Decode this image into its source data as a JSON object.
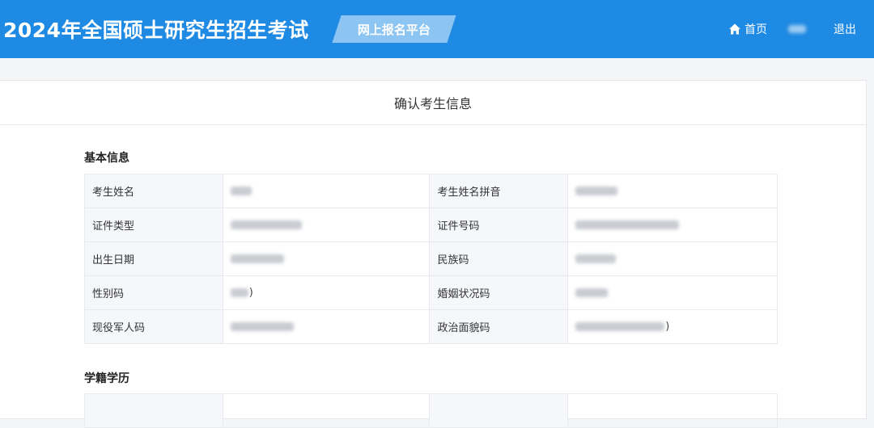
{
  "header": {
    "title": "2024年全国硕士研究生招生考试",
    "platform": "网上报名平台",
    "nav": {
      "home": "首页",
      "logout": "退出"
    }
  },
  "page": {
    "title": "确认考生信息"
  },
  "basic_info": {
    "section_title": "基本信息",
    "rows": [
      {
        "label_a": "考生姓名",
        "label_b": "考生姓名拼音"
      },
      {
        "label_a": "证件类型",
        "label_b": "证件号码"
      },
      {
        "label_a": "出生日期",
        "label_b": "民族码"
      },
      {
        "label_a": "性别码",
        "label_b": "婚姻状况码"
      },
      {
        "label_a": "现役军人码",
        "label_b": "政治面貌码"
      }
    ]
  },
  "education": {
    "section_title": "学籍学历"
  },
  "colors": {
    "header_bg": "#1f8ae3",
    "badge_bg": "#8cc4f2"
  },
  "icons": {
    "home": "home-icon"
  }
}
